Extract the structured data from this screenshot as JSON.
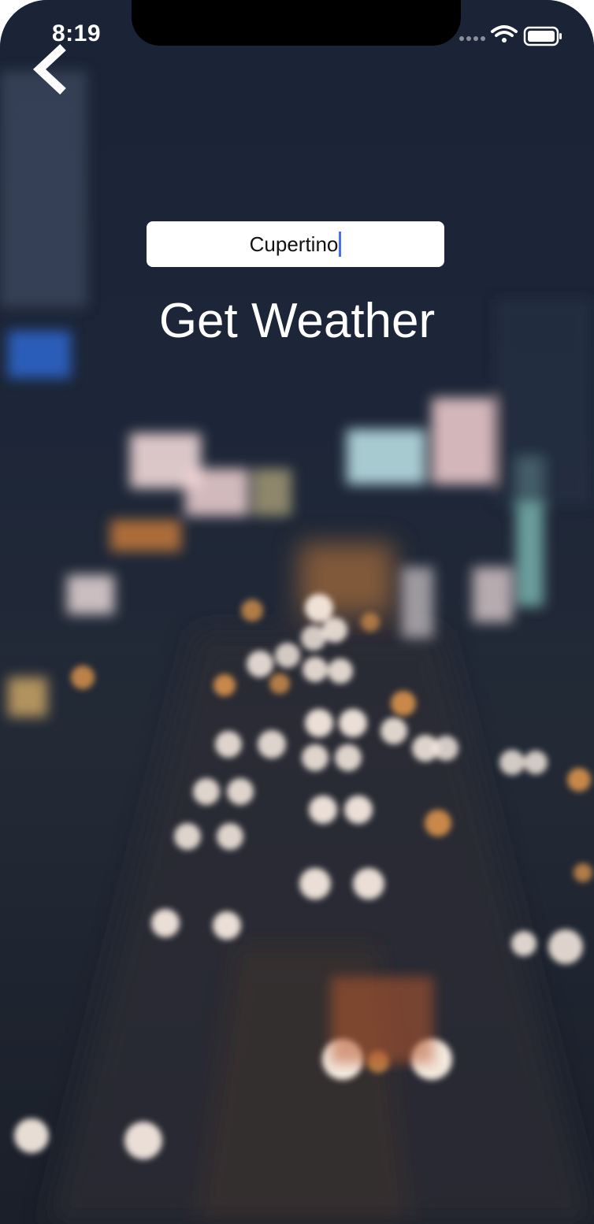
{
  "status_bar": {
    "time": "8:19",
    "signal_icon": "cellular-dots-icon",
    "wifi_icon": "wifi-icon",
    "battery_icon": "battery-icon"
  },
  "nav": {
    "back_icon": "chevron-left-icon"
  },
  "search": {
    "value": "Cupertino"
  },
  "action": {
    "label": "Get Weather"
  },
  "colors": {
    "background": "#1b2535",
    "caret": "#4a72e8",
    "text": "#ffffff"
  }
}
